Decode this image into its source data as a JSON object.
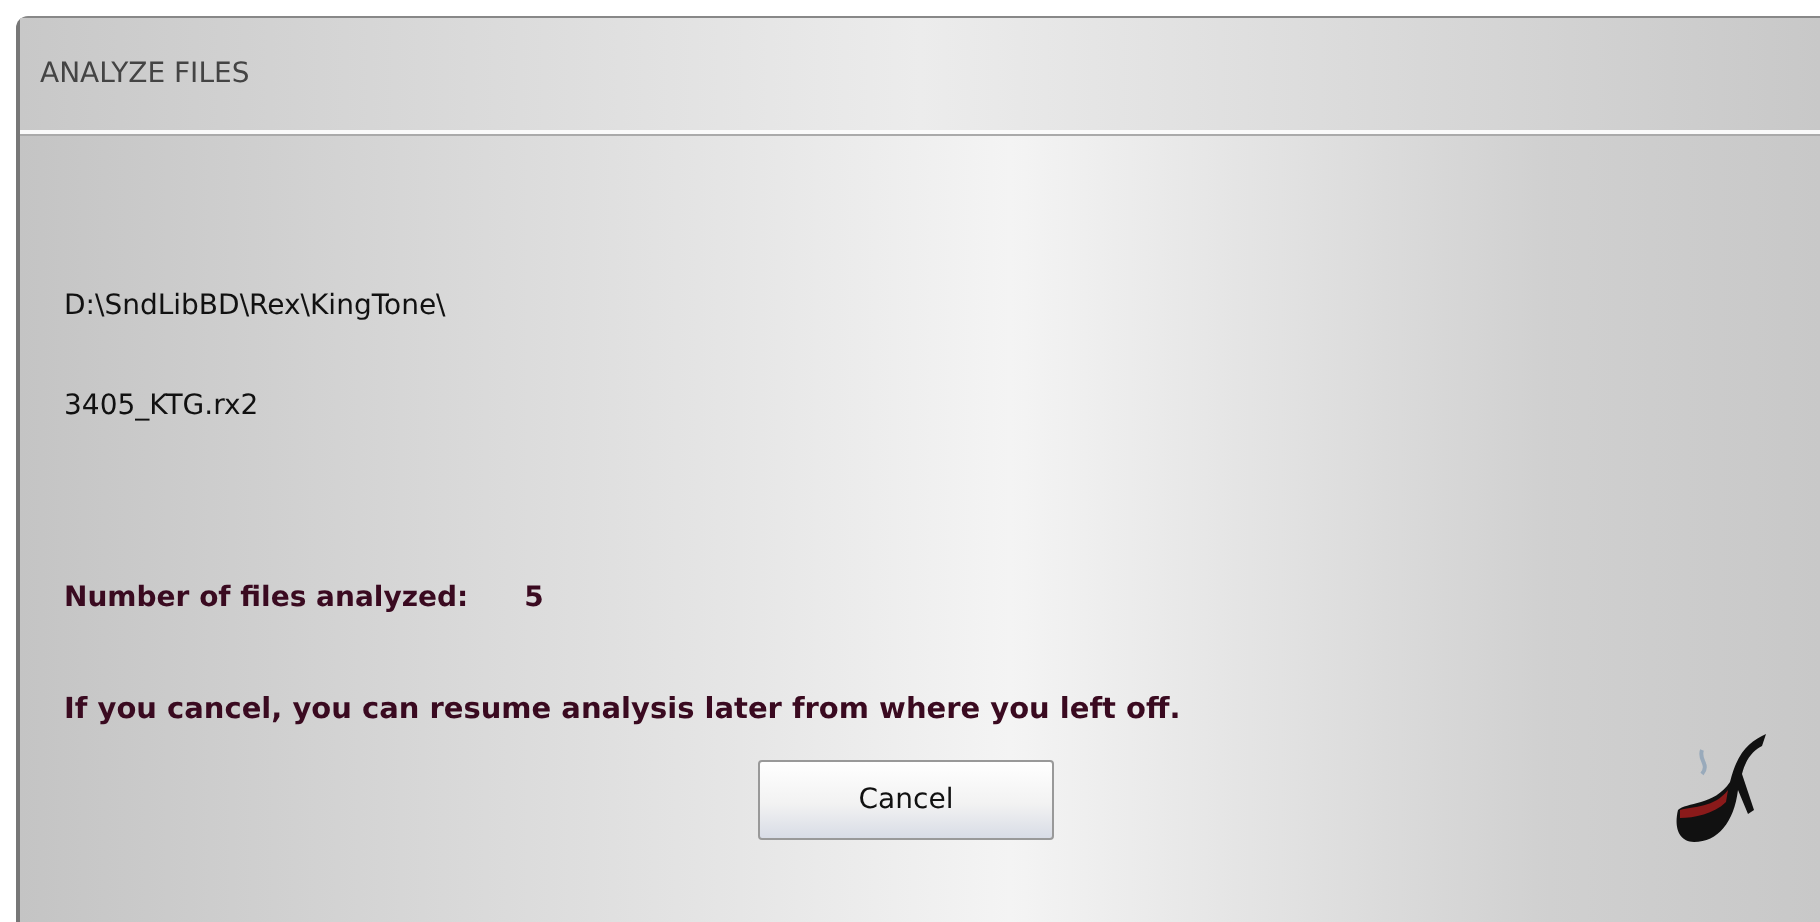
{
  "window": {
    "title": "ANALYZE FILES"
  },
  "folder_path": "D:\\SndLibBD\\Rex\\KingTone\\",
  "file_name": "3405_KTG.rx2",
  "count": {
    "label": "Number of files analyzed:",
    "value": "5"
  },
  "notice": "If you cancel, you can resume analysis later from where you left off.",
  "buttons": [
    "Cancel"
  ]
}
